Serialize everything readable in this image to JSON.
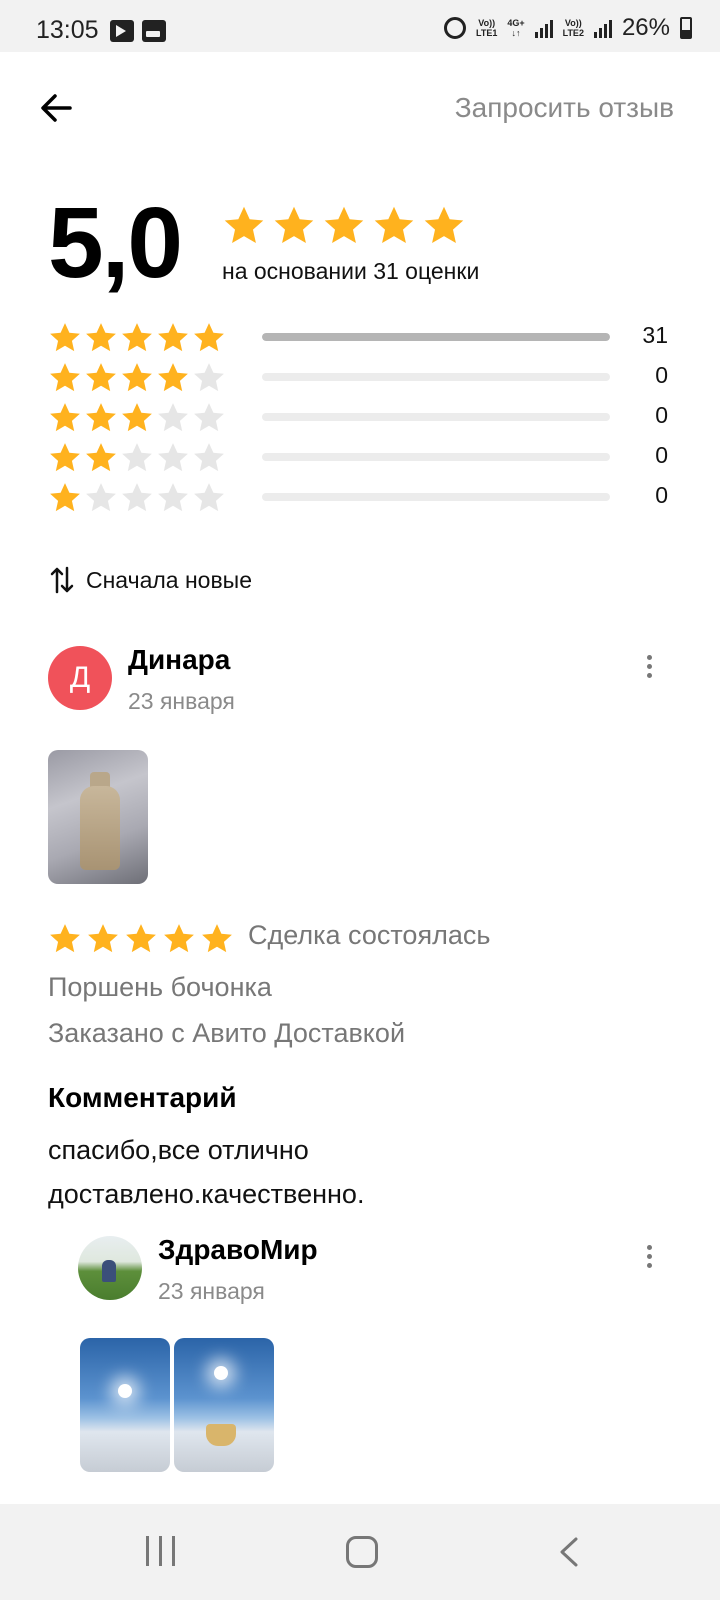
{
  "status_bar": {
    "time": "13:05",
    "battery": "26%",
    "sim1_top": "Vo))",
    "sim1_bottom": "LTE1",
    "net_top": "4G+",
    "sim2_top": "Vo))",
    "sim2_bottom": "LTE2"
  },
  "header": {
    "back_icon": "arrow-left-icon",
    "request_label": "Запросить отзыв"
  },
  "summary": {
    "rating": "5,0",
    "stars": 5,
    "basis": "на основании 31 оценки"
  },
  "breakdown": [
    {
      "stars": 5,
      "count": "31",
      "fraction": 1.0
    },
    {
      "stars": 4,
      "count": "0",
      "fraction": 0
    },
    {
      "stars": 3,
      "count": "0",
      "fraction": 0
    },
    {
      "stars": 2,
      "count": "0",
      "fraction": 0
    },
    {
      "stars": 1,
      "count": "0",
      "fraction": 0
    }
  ],
  "sort": {
    "icon": "sort-arrows-icon",
    "label": "Сначала новые"
  },
  "review": {
    "avatar_letter": "Д",
    "author": "Динара",
    "date": "23 января",
    "stars": 5,
    "deal_status": "Сделка состоялась",
    "item": "Поршень бочонка",
    "delivery": "Заказано с Авито Доставкой",
    "comment_title": "Комментарий",
    "comment": "спасибо,все отлично доставлено.качественно."
  },
  "seller_reply": {
    "name": "ЗдравоМир",
    "date": "23 января"
  },
  "colors": {
    "star_active": "#ffb21e",
    "star_inactive": "#e6e6e6",
    "avatar_bg": "#f0525a",
    "muted_text": "#8a8a8a"
  }
}
